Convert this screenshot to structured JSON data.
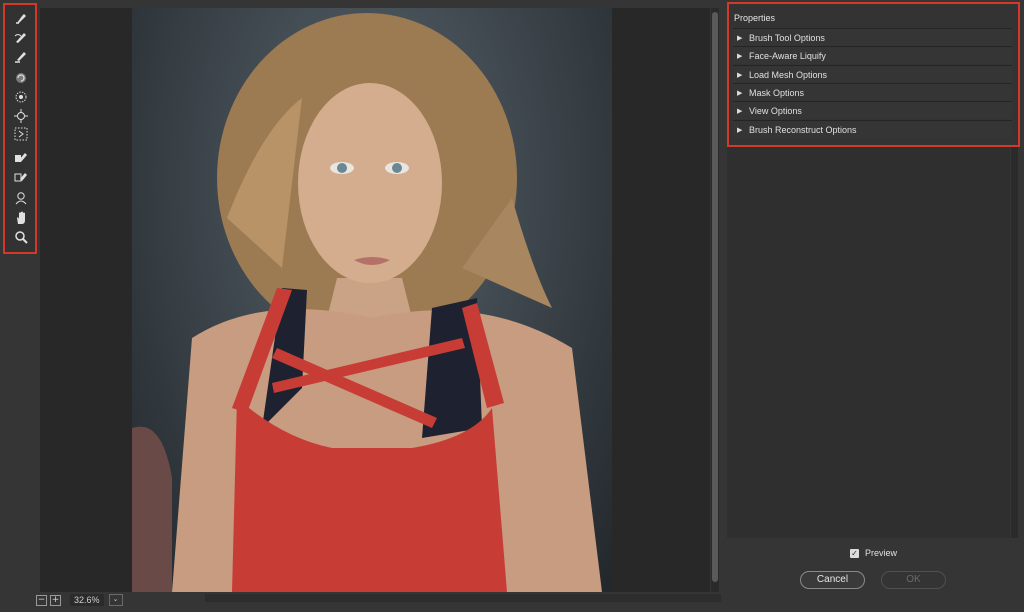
{
  "toolbar": {
    "tools": [
      {
        "name": "forward-warp-tool",
        "icon": "warp-finger-icon"
      },
      {
        "name": "reconstruct-tool",
        "icon": "reconstruct-brush-icon"
      },
      {
        "name": "smooth-tool",
        "icon": "smooth-brush-icon"
      },
      {
        "name": "twirl-clockwise-tool",
        "icon": "twirl-icon"
      },
      {
        "name": "pucker-tool",
        "icon": "pucker-icon"
      },
      {
        "name": "bloat-tool",
        "icon": "bloat-icon"
      },
      {
        "name": "push-left-tool",
        "icon": "push-left-icon"
      },
      {
        "name": "freeze-mask-tool",
        "icon": "freeze-mask-icon"
      },
      {
        "name": "thaw-mask-tool",
        "icon": "thaw-mask-icon"
      },
      {
        "name": "face-tool",
        "icon": "face-person-icon"
      },
      {
        "name": "hand-tool",
        "icon": "hand-icon"
      },
      {
        "name": "zoom-tool",
        "icon": "magnifier-icon"
      }
    ]
  },
  "properties": {
    "title": "Properties",
    "sections": [
      {
        "label": "Brush Tool Options"
      },
      {
        "label": "Face-Aware Liquify"
      },
      {
        "label": "Load Mesh Options"
      },
      {
        "label": "Mask Options"
      },
      {
        "label": "View Options"
      },
      {
        "label": "Brush Reconstruct Options"
      }
    ]
  },
  "footer": {
    "preview_label": "Preview",
    "preview_checked": true,
    "cancel_label": "Cancel",
    "ok_label": "OK"
  },
  "status": {
    "zoom_out": "−",
    "zoom_in": "+",
    "zoom": "32.6%",
    "zoom_dropdown": "⌄"
  },
  "colors": {
    "highlight": "#d2392b",
    "background": "#353535",
    "canvas": "#282828"
  }
}
